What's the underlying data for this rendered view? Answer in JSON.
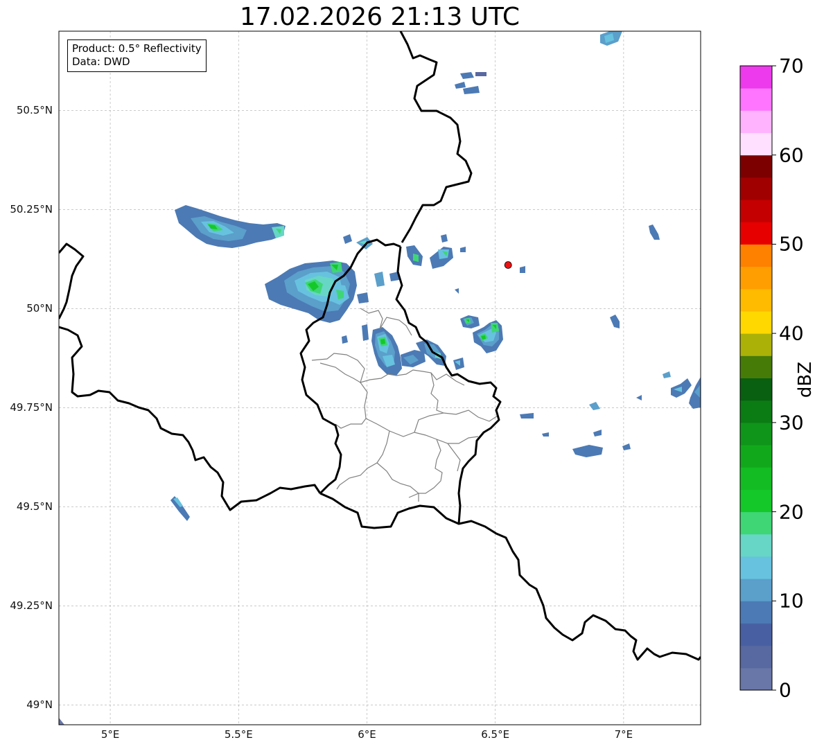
{
  "title": "17.02.2026 21:13 UTC",
  "info_box": {
    "product": "Product: 0.5° Reflectivity",
    "data": "Data: DWD"
  },
  "map": {
    "lat_range": [
      48.95,
      50.7
    ],
    "lon_range": [
      4.8,
      7.3
    ],
    "lat_ticks": [
      {
        "value": 49.0,
        "label": "49°N"
      },
      {
        "value": 49.25,
        "label": "49.25°N"
      },
      {
        "value": 49.5,
        "label": "49.5°N"
      },
      {
        "value": 49.75,
        "label": "49.75°N"
      },
      {
        "value": 50.0,
        "label": "50°N"
      },
      {
        "value": 50.25,
        "label": "50.25°N"
      },
      {
        "value": 50.5,
        "label": "50.5°N"
      }
    ],
    "lon_ticks": [
      {
        "value": 5.0,
        "label": "5°E"
      },
      {
        "value": 5.5,
        "label": "5.5°E"
      },
      {
        "value": 6.0,
        "label": "6°E"
      },
      {
        "value": 6.5,
        "label": "6.5°E"
      },
      {
        "value": 7.0,
        "label": "7°E"
      }
    ],
    "radar_site": {
      "lon": 6.55,
      "lat": 50.11,
      "color": "#ee1111"
    },
    "colors": {
      "national_border": "#000000",
      "regional_border": "#808080",
      "grid": "#aaaaaa"
    }
  },
  "colorbar": {
    "label": "dBZ",
    "min": 0,
    "max": 70,
    "ticks": [
      {
        "value": 0,
        "label": "0"
      },
      {
        "value": 10,
        "label": "10"
      },
      {
        "value": 20,
        "label": "20"
      },
      {
        "value": 30,
        "label": "30"
      },
      {
        "value": 40,
        "label": "40"
      },
      {
        "value": 50,
        "label": "50"
      },
      {
        "value": 60,
        "label": "60"
      },
      {
        "value": 70,
        "label": "70"
      }
    ],
    "bands": [
      "#6876a8",
      "#5868a0",
      "#4860a2",
      "#4c7ab4",
      "#5b9fcb",
      "#67c2df",
      "#67d6c6",
      "#3fd676",
      "#14c829",
      "#12bc22",
      "#11a91b",
      "#0f951a",
      "#0b7b13",
      "#086010",
      "#467b08",
      "#acb108",
      "#ffd800",
      "#ffbb00",
      "#ff9e00",
      "#ff8100",
      "#e70000",
      "#c40000",
      "#a10000",
      "#7d0000",
      "#ffe0ff",
      "#ffb3ff",
      "#ff75ff",
      "#ec3aec"
    ]
  }
}
